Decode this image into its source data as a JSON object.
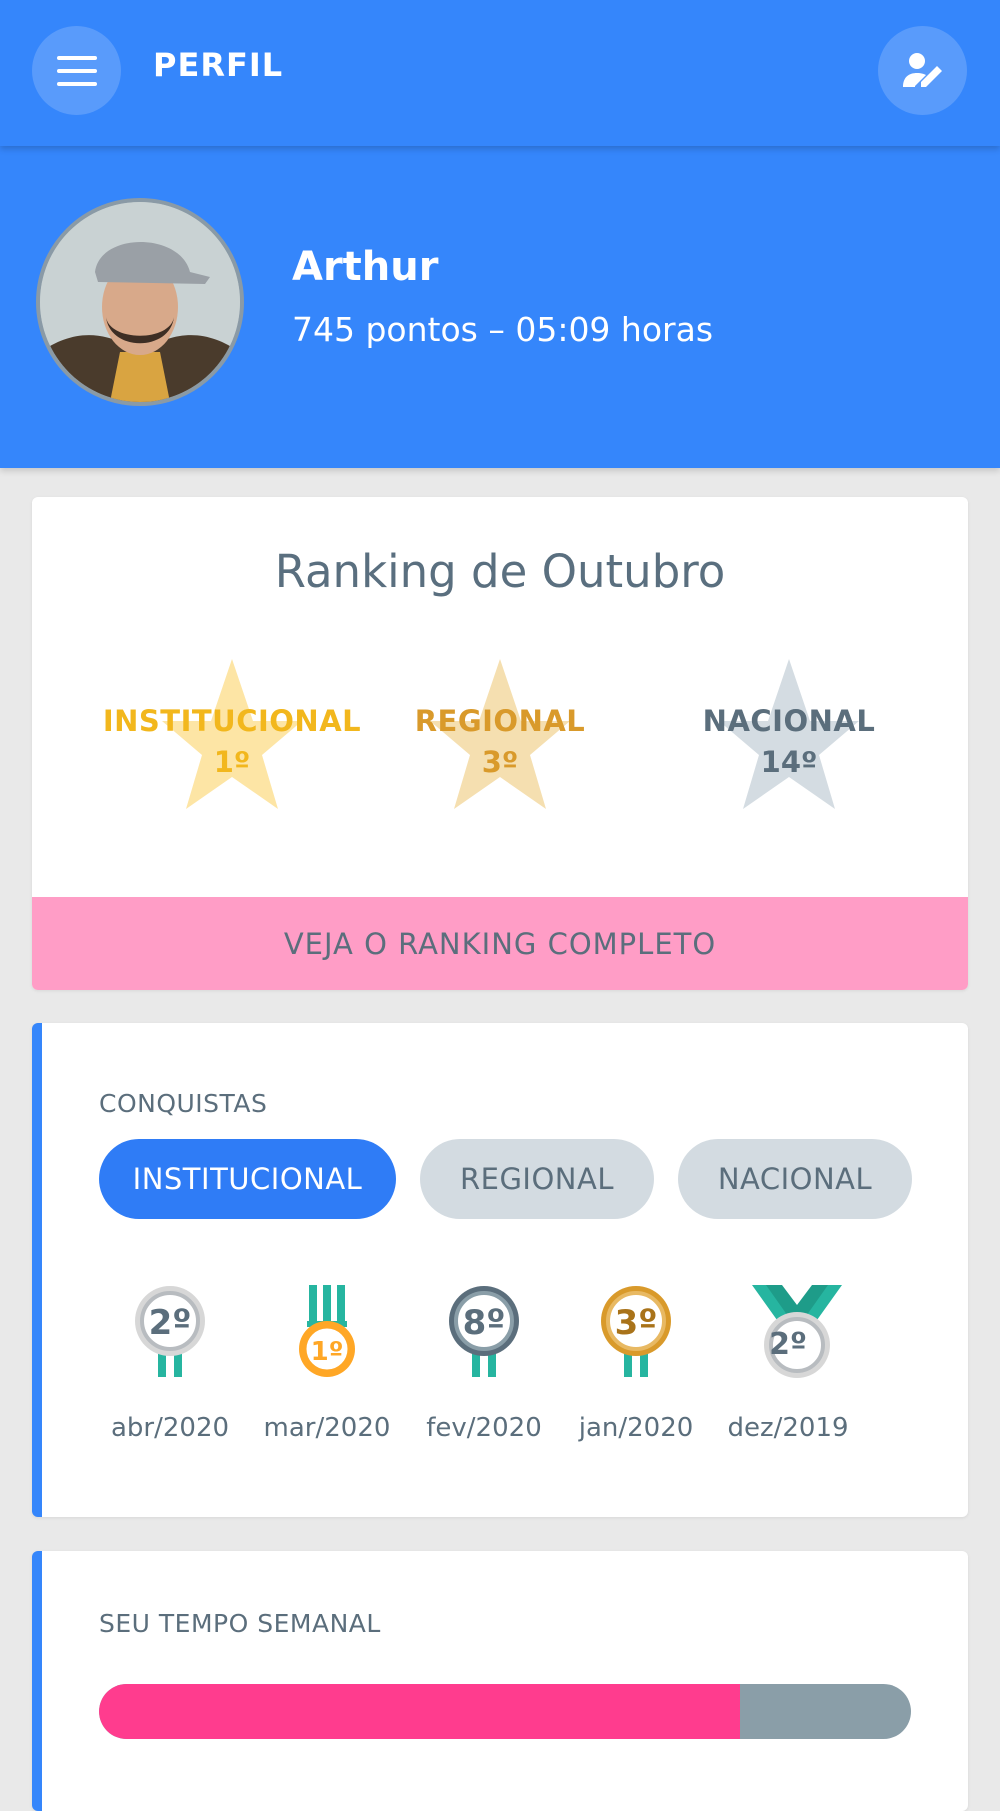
{
  "app_bar": {
    "title": "PERFIL",
    "menu_icon": "menu-icon",
    "edit_icon": "edit-profile-icon"
  },
  "profile": {
    "name": "Arthur",
    "stats": "745 pontos – 05:09 horas"
  },
  "ranking": {
    "title": "Ranking de Outubro",
    "items": [
      {
        "label": "INSTITUCIONAL",
        "position": "1º",
        "star_color": "#fde5a5",
        "text_color": "#f2b71d"
      },
      {
        "label": "REGIONAL",
        "position": "3º",
        "star_color": "#f5dfb0",
        "text_color": "#d99a2b"
      },
      {
        "label": "NACIONAL",
        "position": "14º",
        "star_color": "#d4dce2",
        "text_color": "#5b6e7c"
      }
    ],
    "button_label": "VEJA O RANKING COMPLETO"
  },
  "conquistas": {
    "label": "CONQUISTAS",
    "tabs": [
      {
        "label": "INSTITUCIONAL",
        "active": true
      },
      {
        "label": "REGIONAL",
        "active": false
      },
      {
        "label": "NACIONAL",
        "active": false
      }
    ],
    "medals": [
      {
        "position": "2º",
        "date": "abr/2020",
        "color": "#b8bcc0"
      },
      {
        "position": "1º",
        "date": "mar/2020",
        "color": "#ffa726"
      },
      {
        "position": "8º",
        "date": "fev/2020",
        "color": "#5b6e7c"
      },
      {
        "position": "3º",
        "date": "jan/2020",
        "color": "#d99a2b"
      },
      {
        "position": "2º",
        "date": "dez/2019",
        "color": "#b8bcc0"
      }
    ]
  },
  "weekly_time": {
    "label": "SEU TEMPO SEMANAL",
    "progress_percent": 79
  },
  "colors": {
    "primary": "#3586fb",
    "accent_pink": "#ff3c8e",
    "ranking_button": "#ff9dc6"
  }
}
